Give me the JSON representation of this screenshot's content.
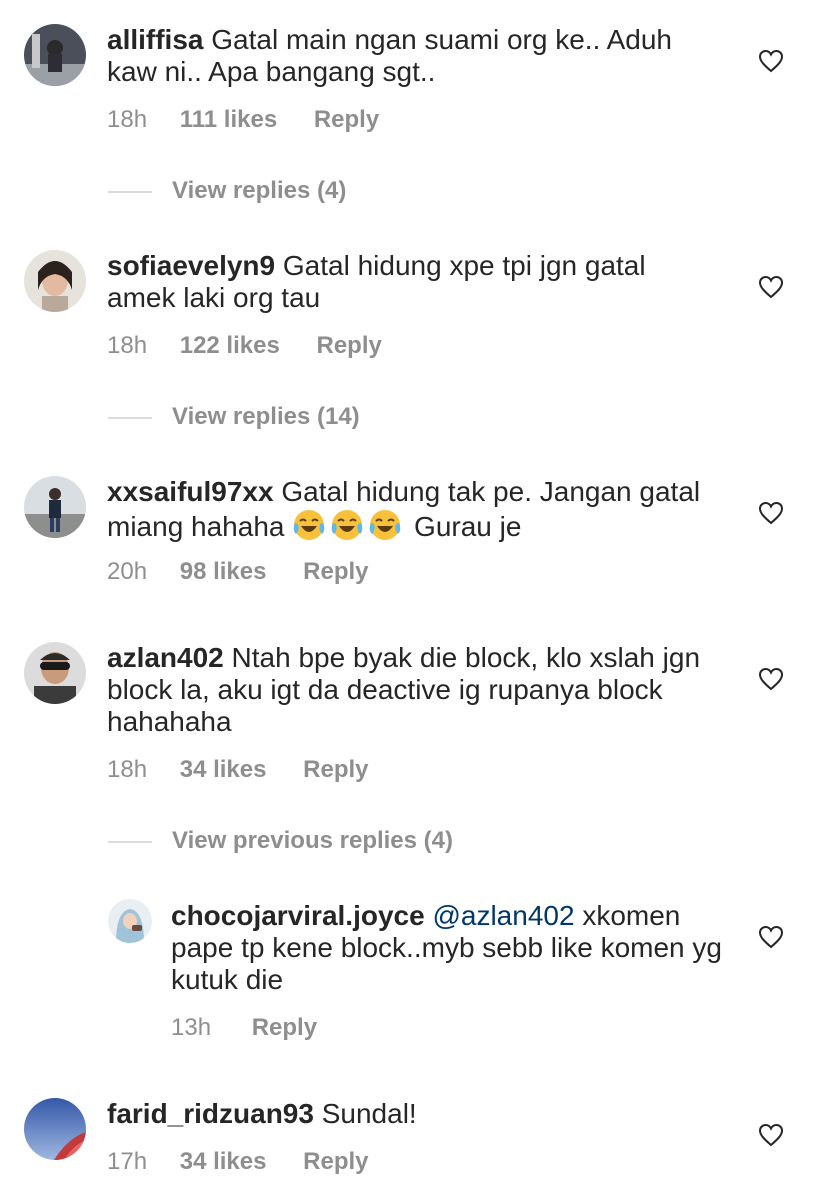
{
  "comments": [
    {
      "username": "alliffisa",
      "text": "Gatal main ngan suami org ke.. Aduh kaw ni.. Apa bangang sgt..",
      "time": "18h",
      "likes": "111 likes",
      "reply": "Reply",
      "view_replies": "View replies (4)"
    },
    {
      "username": "sofiaevelyn9",
      "text": "Gatal hidung xpe tpi jgn gatal amek laki org tau",
      "time": "18h",
      "likes": "122 likes",
      "reply": "Reply",
      "view_replies": "View replies (14)"
    },
    {
      "username": "xxsaiful97xx",
      "text_a": "Gatal hidung tak pe. Jangan gatal miang hahaha",
      "text_b": "Gurau je",
      "time": "20h",
      "likes": "98 likes",
      "reply": "Reply"
    },
    {
      "username": "azlan402",
      "text": "Ntah bpe byak die block, klo xslah jgn block la, aku igt da deactive ig rupanya block hahahaha",
      "time": "18h",
      "likes": "34 likes",
      "reply": "Reply",
      "view_previous_replies": "View previous replies (4)"
    },
    {
      "username": "chocojarviral.joyce",
      "mention": "@azlan402",
      "text": "xkomen pape tp kene block..myb sebb like komen yg kutuk die",
      "time": "13h",
      "reply": "Reply"
    },
    {
      "username": "farid_ridzuan93",
      "text": "Sundal!",
      "time": "17h",
      "likes": "34 likes",
      "reply": "Reply"
    }
  ],
  "icons": {
    "like": "heart-outline-icon",
    "emoji": "face-with-tears-of-joy"
  },
  "colors": {
    "text": "#262626",
    "meta": "#8e8e8e",
    "mention": "#00376b"
  }
}
